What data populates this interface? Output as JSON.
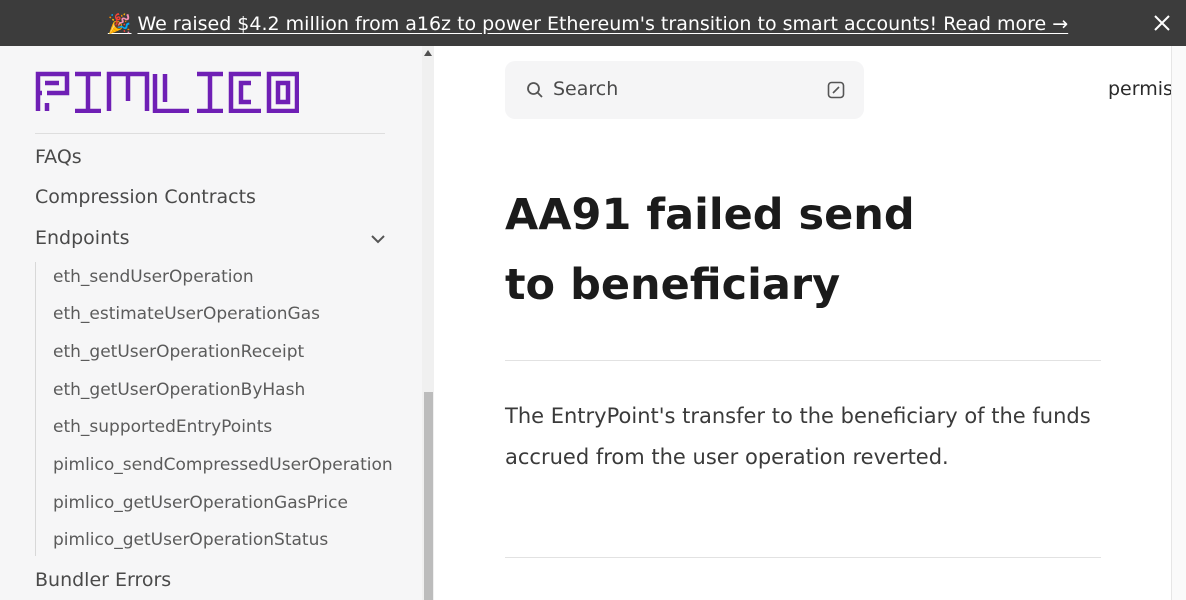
{
  "banner": {
    "emoji": "🎉",
    "text": "We raised $4.2 million from a16z to power Ethereum's transition to smart accounts! Read more →"
  },
  "sidebar": {
    "logo_text": "PIMLICO",
    "items": [
      {
        "label": "FAQs"
      },
      {
        "label": "Compression Contracts"
      },
      {
        "label": "Endpoints",
        "expanded": true
      }
    ],
    "endpoints": [
      "eth_sendUserOperation",
      "eth_estimateUserOperationGas",
      "eth_getUserOperationReceipt",
      "eth_getUserOperationByHash",
      "eth_supportedEntryPoints",
      "pimlico_sendCompressedUserOperation",
      "pimlico_getUserOperationGasPrice",
      "pimlico_getUserOperationStatus"
    ],
    "bundler_errors": "Bundler Errors"
  },
  "search": {
    "label": "Search"
  },
  "header": {
    "link": "permis"
  },
  "page": {
    "title": "AA91 failed send to beneficiary",
    "body": "The EntryPoint's transfer to the beneficiary of the funds accrued from the user operation reverted."
  },
  "colors": {
    "brand": "#6f1fb5",
    "banner_bg": "#3c3c3c"
  }
}
